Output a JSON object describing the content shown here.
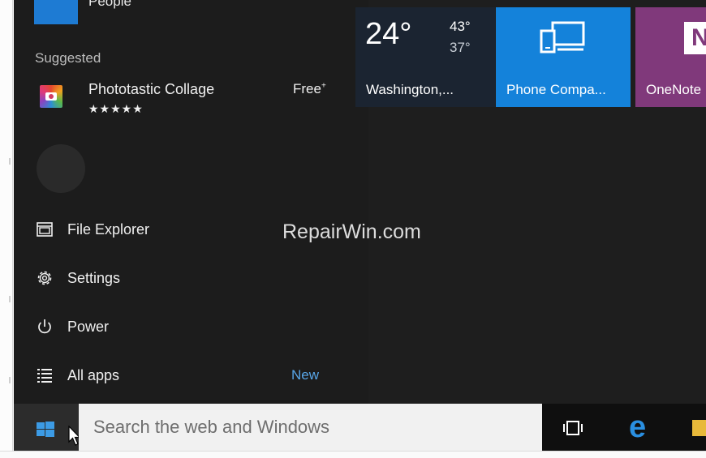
{
  "people": {
    "label": "People"
  },
  "suggested": {
    "heading": "Suggested",
    "app": {
      "name": "Phototastic Collage",
      "rating": "★★★★★",
      "rating_value": 4.5,
      "price": "Free",
      "price_mark": "+"
    }
  },
  "nav": {
    "file_explorer": "File Explorer",
    "settings": "Settings",
    "power": "Power",
    "all_apps": "All apps",
    "new_badge": "New"
  },
  "watermark": "RepairWin.com",
  "tiles": {
    "weather": {
      "temp": "24°",
      "high": "43°",
      "low": "37°",
      "location": "Washington,..."
    },
    "phone": {
      "label": "Phone Compa..."
    },
    "onenote": {
      "label": "OneNote"
    }
  },
  "taskbar": {
    "search_placeholder": "Search the web and Windows"
  },
  "colors": {
    "accent": "#1482da",
    "onenote": "#80397b",
    "new_badge": "#58a6e8",
    "windows_logo": "#3c9be5",
    "edge": "#2a8fe1"
  }
}
